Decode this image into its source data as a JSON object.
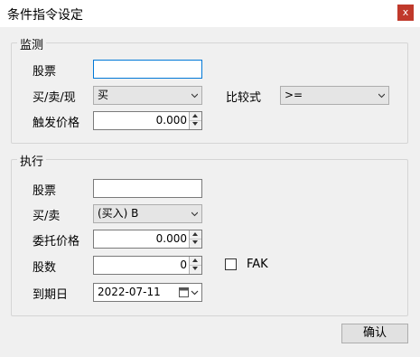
{
  "window": {
    "title": "条件指令设定",
    "close_label": "x"
  },
  "monitor": {
    "legend": "监测",
    "stock_label": "股票",
    "stock_value": "",
    "side_label": "买/卖/现",
    "side_value": "买",
    "compare_label": "比较式",
    "compare_value": ">=",
    "trigger_label": "触发价格",
    "trigger_value": "0.000"
  },
  "execute": {
    "legend": "执行",
    "stock_label": "股票",
    "stock_value": "",
    "side_label": "买/卖",
    "side_value": "(买入) B",
    "price_label": "委托价格",
    "price_value": "0.000",
    "qty_label": "股数",
    "qty_value": "0",
    "fak_label": "FAK",
    "fak_checked": false,
    "expiry_label": "到期日",
    "expiry_value": "2022-07-11"
  },
  "buttons": {
    "confirm_label": "确认"
  }
}
